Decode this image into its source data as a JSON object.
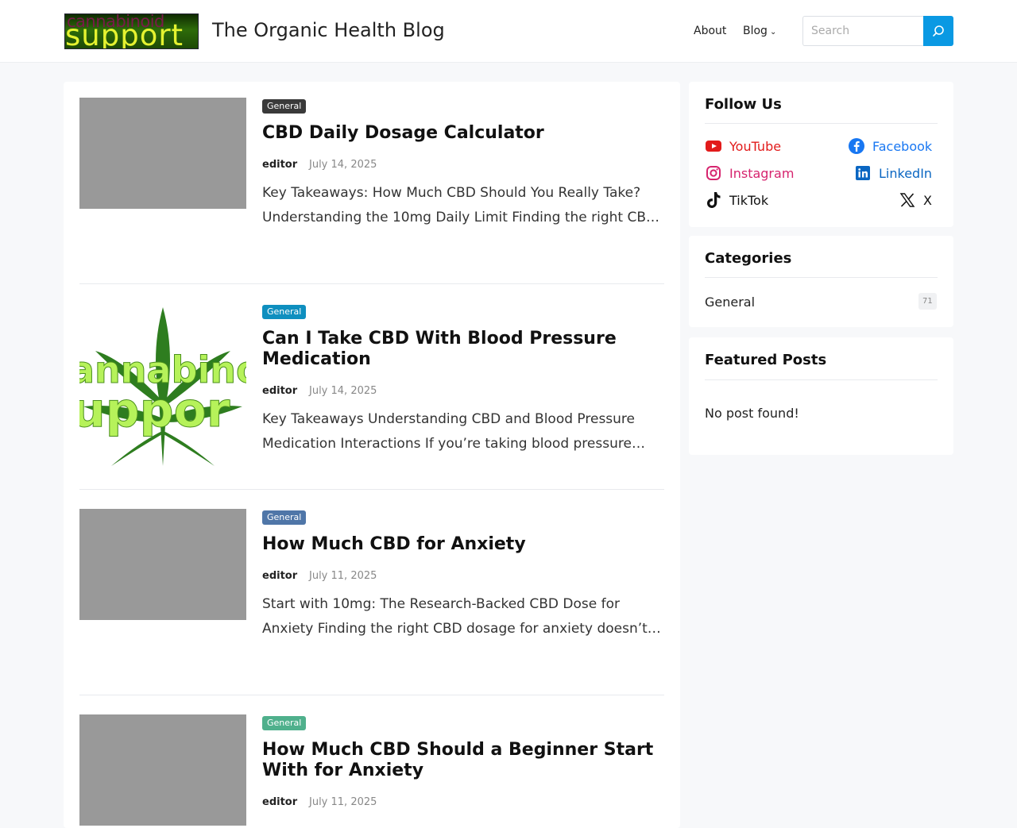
{
  "header": {
    "logo_text_top": "cannabinoid",
    "logo_text_bottom": "support",
    "site_title": "The Organic Health Blog",
    "nav": {
      "about": "About",
      "blog": "Blog"
    },
    "search_placeholder": "Search"
  },
  "posts": [
    {
      "category": "General",
      "title": "CBD Daily Dosage Calculator",
      "author": "editor",
      "date": "July 14, 2025",
      "excerpt_line1": "Key Takeaways: How Much CBD Should You Really Take?",
      "excerpt_line2": "Understanding the 10mg Daily Limit Finding the right CB…",
      "badge_color": "#3a3a3a"
    },
    {
      "category": "General",
      "title": "Can I Take CBD With Blood Pressure Medication",
      "author": "editor",
      "date": "July 14, 2025",
      "excerpt_line1": "Key Takeaways Understanding CBD and Blood Pressure",
      "excerpt_line2": "Medication Interactions If you’re taking blood pressure…",
      "badge_color": "#0e8fbf",
      "thumb_text_top": "annabino",
      "thumb_text_bottom": "uppor"
    },
    {
      "category": "General",
      "title": "How Much CBD for Anxiety",
      "author": "editor",
      "date": "July 11, 2025",
      "excerpt_line1": "Start with 10mg: The Research-Backed CBD Dose for",
      "excerpt_line2": "Anxiety Finding the right CBD dosage for anxiety doesn’t…",
      "badge_color": "#4f76a8"
    },
    {
      "category": "General",
      "title": "How Much CBD Should a Beginner Start With for Anxiety",
      "author": "editor",
      "date": "July 11, 2025",
      "badge_color": "#4fb08c"
    }
  ],
  "sidebar": {
    "follow_title": "Follow Us",
    "social": [
      {
        "label": "YouTube",
        "icon": "youtube-icon",
        "color": "#e21b1b"
      },
      {
        "label": "Facebook",
        "icon": "facebook-icon",
        "color": "#1877f2"
      },
      {
        "label": "Instagram",
        "icon": "instagram-icon",
        "color": "#d6246e"
      },
      {
        "label": "LinkedIn",
        "icon": "linkedin-icon",
        "color": "#0a66c2"
      },
      {
        "label": "TikTok",
        "icon": "tiktok-icon",
        "color": "#111111"
      },
      {
        "label": "X",
        "icon": "x-icon",
        "color": "#111111"
      }
    ],
    "categories_title": "Categories",
    "categories": [
      {
        "name": "General",
        "count": "71"
      }
    ],
    "featured_title": "Featured Posts",
    "featured_empty": "No post found!"
  },
  "colors": {
    "accent": "#0a99e3"
  }
}
